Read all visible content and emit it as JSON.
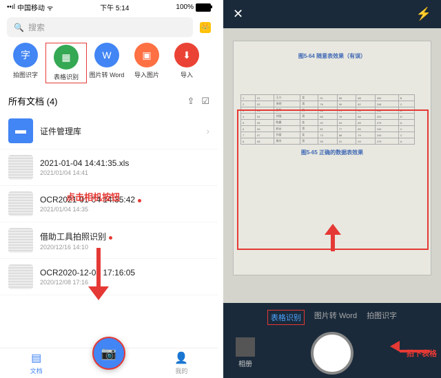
{
  "status": {
    "carrier": "中国移动",
    "time": "下午 5:14",
    "battery": "100%"
  },
  "search": {
    "placeholder": "搜索"
  },
  "actions": {
    "a1": "拍图识字",
    "a2": "表格识别",
    "a3": "图片转 Word",
    "a4": "导入图片",
    "a5": "导入"
  },
  "section": {
    "title": "所有文档 (4)"
  },
  "items": {
    "folder": "证件管理库",
    "f1": {
      "title": "2021-01-04 14:41:35.xls",
      "sub": "2021/01/04 14:41"
    },
    "anno1": "点击相机按钮",
    "f2": {
      "title": "OCR2021-01-04 14:35:42",
      "sub": "2021/01/04 14:35"
    },
    "f3": {
      "title": "借助工具拍照识别",
      "sub": "2020/12/16 14:10"
    },
    "f4": {
      "title": "OCR2020-12-08 17:16:05",
      "sub": "2020/12/08 17:16"
    }
  },
  "nav": {
    "docs": "文档",
    "mine": "我的"
  },
  "cam": {
    "pageTop": "图5-64 随意表效果（有误）",
    "pageBot": "图5-65 正确的数据表效果",
    "tab1": "表格识别",
    "tab2": "图片转 Word",
    "tab3": "拍图识字",
    "album": "相册",
    "anno": "拍下表格"
  }
}
